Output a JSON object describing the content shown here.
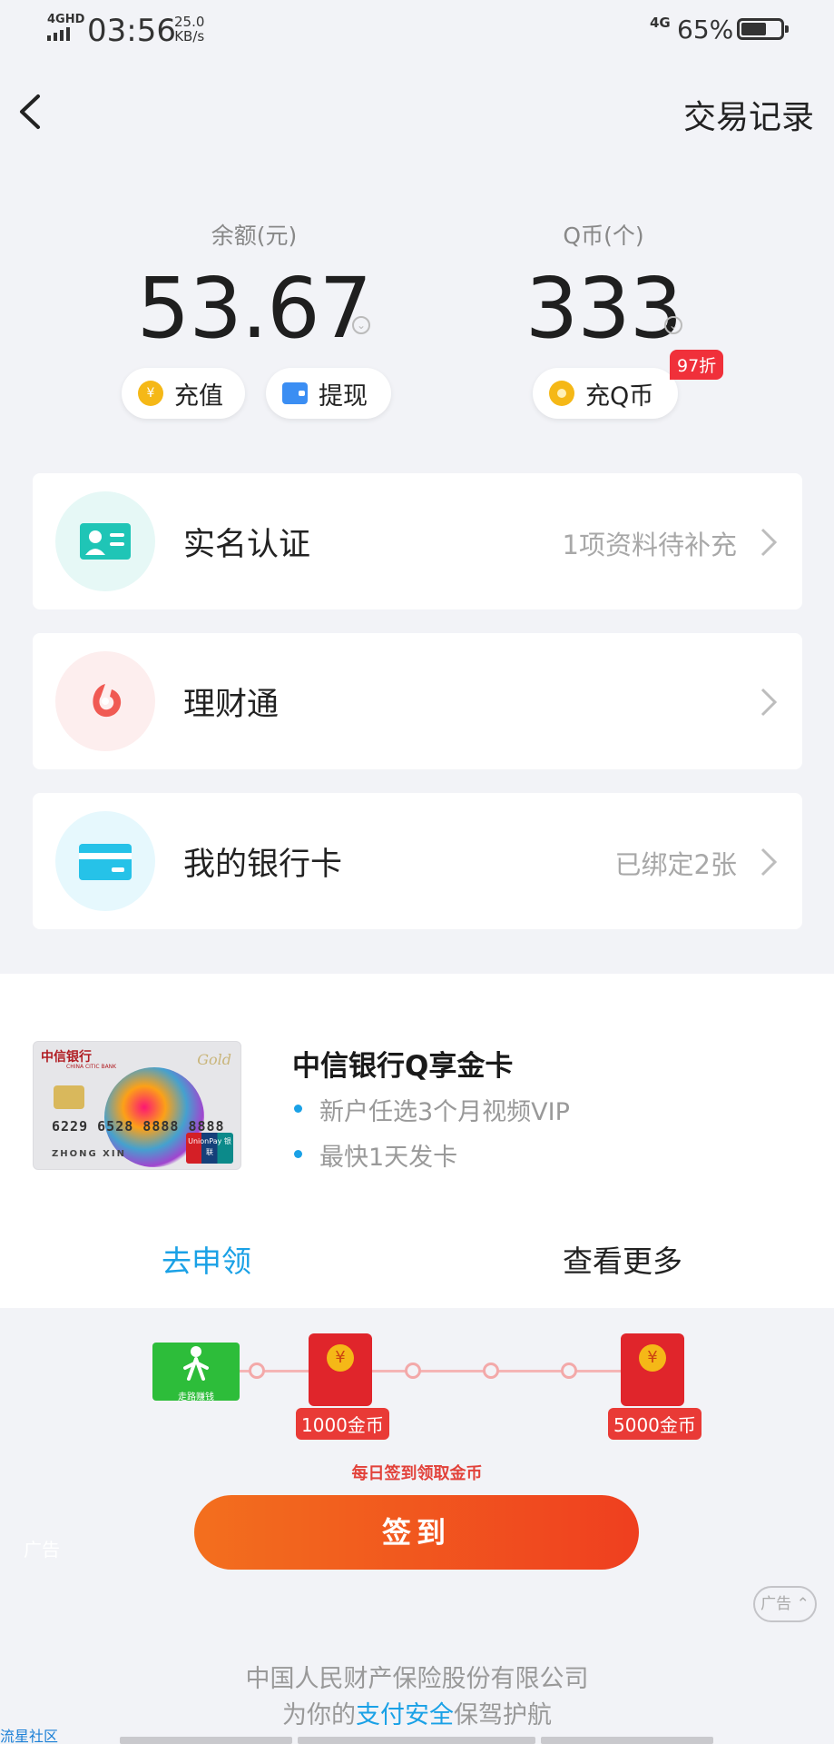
{
  "status_bar": {
    "network": "4GHD",
    "time": "03:56",
    "speed_value": "25.0",
    "speed_unit": "KB/s",
    "network_right": "4G",
    "battery_percent": "65%",
    "battery_level": 0.65
  },
  "nav": {
    "right_link": "交易记录"
  },
  "balance": {
    "label": "余额(元)",
    "value": "53.67",
    "recharge_label": "充值",
    "withdraw_label": "提现"
  },
  "qcoin": {
    "label": "Q币(个)",
    "value": "333",
    "recharge_label": "充Q币",
    "discount_badge": "97折"
  },
  "list": [
    {
      "title": "实名认证",
      "subtitle": "1项资料待补充",
      "icon": "id-card-icon",
      "icon_color": "#1fc5b6"
    },
    {
      "title": "理财通",
      "subtitle": "",
      "icon": "licaitong-icon",
      "icon_color": "#f05a53"
    },
    {
      "title": "我的银行卡",
      "subtitle": "已绑定2张",
      "icon": "bank-card-icon",
      "icon_color": "#26c2e8"
    }
  ],
  "promo": {
    "title": "中信银行Q享金卡",
    "bullets": [
      "新户任选3个月视频VIP",
      "最快1天发卡"
    ],
    "card_bank": "中信银行",
    "card_bank_en": "CHINA CITIC BANK",
    "card_gold": "Gold",
    "card_number": "6229 6528 8888 8888",
    "card_name": "ZHONG XIN",
    "card_network": "UnionPay 银联",
    "apply_label": "去申领",
    "more_label": "查看更多",
    "accent_color": "#1aa1e6"
  },
  "ad": {
    "step_label": "走路赚钱",
    "reward_1": "1000金币",
    "reward_2": "5000金币",
    "caption": "每日签到领取金币",
    "signin_label": "签到",
    "ad_mark": "广告",
    "ad_tag": "广告"
  },
  "footer": {
    "line1": "中国人民财产保险股份有限公司",
    "line2_pre": "为你的",
    "line2_highlight": "支付安全",
    "line2_post": "保驾护航",
    "watermark": "流星社区"
  }
}
